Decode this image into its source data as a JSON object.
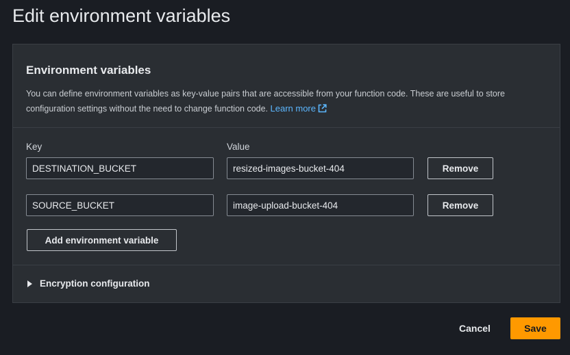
{
  "page": {
    "title": "Edit environment variables"
  },
  "panel": {
    "title": "Environment variables",
    "description": "You can define environment variables as key-value pairs that are accessible from your function code. These are useful to store configuration settings without the need to change function code.",
    "learn_more_label": "Learn more",
    "learn_more_icon": "external-link-icon"
  },
  "columns": {
    "key_label": "Key",
    "value_label": "Value"
  },
  "variables": [
    {
      "key": "DESTINATION_BUCKET",
      "value": "resized-images-bucket-404",
      "remove_label": "Remove"
    },
    {
      "key": "SOURCE_BUCKET",
      "value": "image-upload-bucket-404",
      "remove_label": "Remove"
    }
  ],
  "add_button_label": "Add environment variable",
  "encryption": {
    "label": "Encryption configuration",
    "icon": "caret-right-icon",
    "expanded": false
  },
  "footer": {
    "cancel_label": "Cancel",
    "save_label": "Save"
  },
  "colors": {
    "accent": "#ff9900",
    "link": "#5cb7ff",
    "background": "#1a1d23",
    "panel": "#2a2e33"
  }
}
